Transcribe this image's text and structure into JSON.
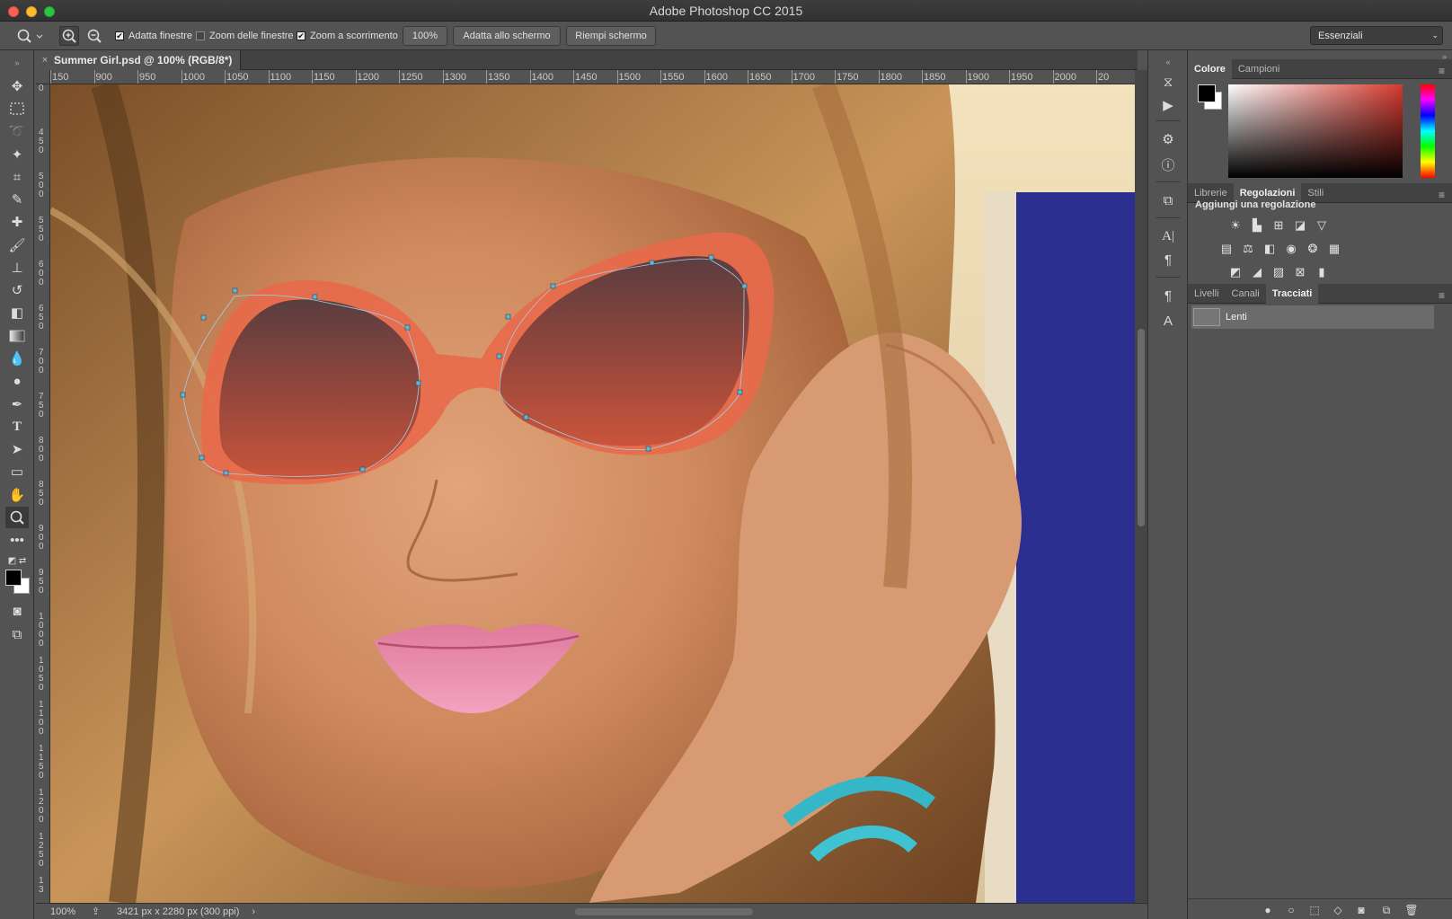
{
  "window": {
    "title": "Adobe Photoshop CC 2015"
  },
  "options_bar": {
    "tool_icon": "zoom-icon",
    "zoom_in_icon": "zoom-in-icon",
    "zoom_out_icon": "zoom-out-icon",
    "resize_windows": {
      "label": "Adatta finestre",
      "checked": true
    },
    "zoom_all_windows": {
      "label": "Zoom delle finestre",
      "checked": false
    },
    "scrubby_zoom": {
      "label": "Zoom a scorrimento",
      "checked": true
    },
    "zoom_value": "100%",
    "fit_screen": "Adatta allo schermo",
    "fill_screen": "Riempi schermo",
    "workspace": "Essenziali"
  },
  "document": {
    "tab_title": "Summer Girl.psd @ 100% (RGB/8*)",
    "close": "×"
  },
  "ruler": {
    "h_ticks": [
      "150",
      "900",
      "950",
      "1000",
      "1050",
      "1100",
      "1150",
      "1200",
      "1250",
      "1300",
      "1350",
      "1400",
      "1450",
      "1500",
      "1550",
      "1600",
      "1650",
      "1700",
      "1750",
      "1800",
      "1850",
      "1900",
      "1950",
      "2000",
      "20"
    ],
    "v_ticks": [
      "0",
      "4\n5\n0",
      "5\n0\n0",
      "5\n5\n0",
      "6\n0\n0",
      "6\n5\n0",
      "7\n0\n0",
      "7\n5\n0",
      "8\n0\n0",
      "8\n5\n0",
      "9\n0\n0",
      "9\n5\n0",
      "1\n0\n0\n0",
      "1\n0\n5\n0",
      "1\n1\n0\n0",
      "1\n1\n5\n0",
      "1\n2\n0\n0",
      "1\n2\n5\n0",
      "1\n3"
    ]
  },
  "status": {
    "zoom": "100%",
    "doc_info": "3421 px x 2280 px (300 ppi)",
    "arrow": "›"
  },
  "panels": {
    "color_tabs": [
      "Colore",
      "Campioni"
    ],
    "adjust_tabs": [
      "Librerie",
      "Regolazioni",
      "Stili"
    ],
    "adjust_heading": "Aggiungi una regolazione",
    "layer_tabs": [
      "Livelli",
      "Canali",
      "Tracciati"
    ],
    "path_item": "Lenti"
  }
}
